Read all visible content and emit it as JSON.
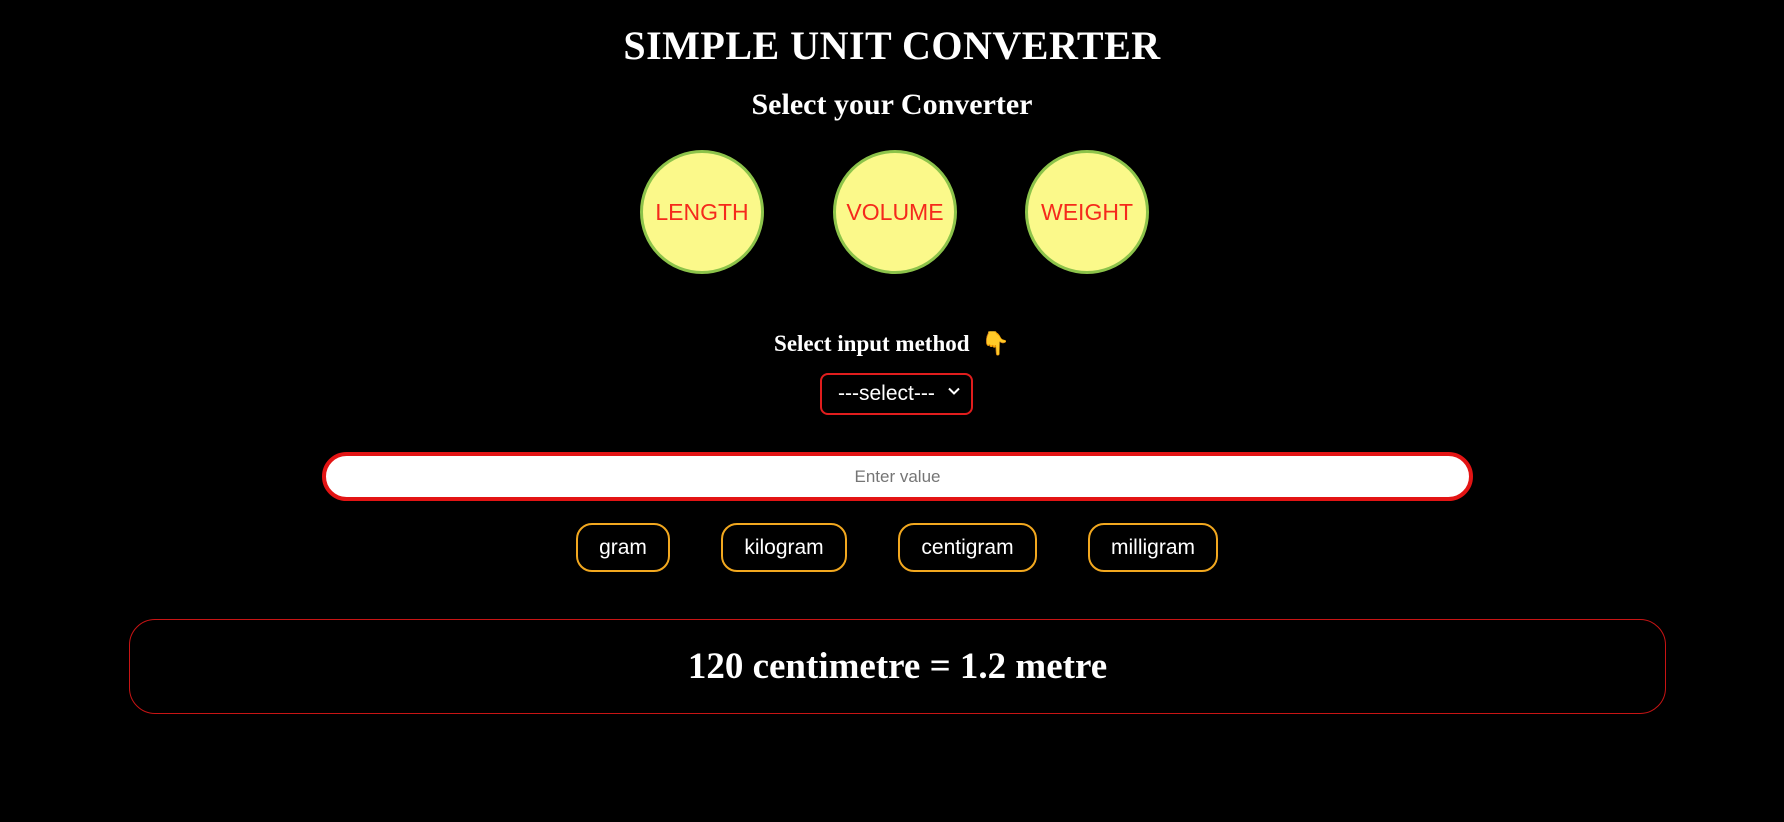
{
  "header": {
    "title": "SIMPLE UNIT CONVERTER",
    "subtitle": "Select your Converter"
  },
  "converters": [
    {
      "label": "LENGTH"
    },
    {
      "label": "VOLUME"
    },
    {
      "label": "WEIGHT"
    }
  ],
  "input_method": {
    "label": "Select input method",
    "emoji": "👇",
    "select_value": "---select---"
  },
  "value_input": {
    "placeholder": "Enter value",
    "value": ""
  },
  "units": [
    {
      "label": "gram"
    },
    {
      "label": "kilogram"
    },
    {
      "label": "centigram"
    },
    {
      "label": "milligram"
    }
  ],
  "result": {
    "text": "120 centimetre = 1.2 metre"
  },
  "colors": {
    "background": "#000000",
    "circle_fill": "#fbf98a",
    "circle_border": "#8cc34a",
    "circle_text": "#f52a1c",
    "input_border": "#e31414",
    "unit_border": "#f2a81f",
    "result_border": "#c81414"
  }
}
